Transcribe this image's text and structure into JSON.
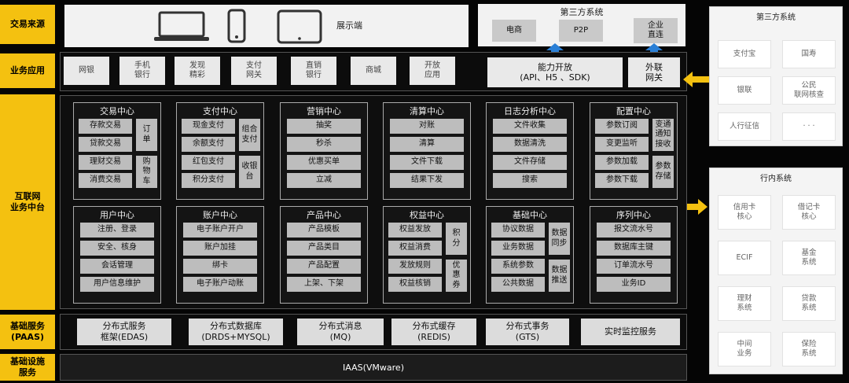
{
  "rows": {
    "source": "交易来源",
    "app": "业务应用",
    "platform": "互联网\n业务中台",
    "paas": "基础服务\n(PAAS)",
    "iaas": "基础设施\n服务"
  },
  "source_bar": {
    "label": "展示端"
  },
  "third_party_top": {
    "title": "第三方系统",
    "items": [
      "电商",
      "P2P",
      "企业\n直连"
    ]
  },
  "apps": [
    "网银",
    "手机\n银行",
    "发现\n精彩",
    "支付\n网关",
    "直销\n银行",
    "商城",
    "开放\n应用"
  ],
  "open_capability": "能力开放\n(API、H5 、SDK)",
  "external_gateway": "外联\n网关",
  "centers_top": [
    {
      "title": "交易中心",
      "left": [
        "存款交易",
        "贷款交易",
        "理财交易",
        "消费交易"
      ],
      "right": [
        "订\n单",
        "购\n物\n车"
      ]
    },
    {
      "title": "支付中心",
      "left": [
        "现金支付",
        "余额支付",
        "红包支付",
        "积分支付"
      ],
      "right": [
        "组合\n支付",
        "收银\n台"
      ]
    },
    {
      "title": "营销中心",
      "items": [
        "抽奖",
        "秒杀",
        "优惠买单",
        "立减"
      ]
    },
    {
      "title": "清算中心",
      "items": [
        "对账",
        "清算",
        "文件下载",
        "结果下发"
      ]
    },
    {
      "title": "日志分析中心",
      "items": [
        "文件收集",
        "数据清洗",
        "文件存储",
        "搜索"
      ]
    },
    {
      "title": "配置中心",
      "left": [
        "参数订阅",
        "变更监听",
        "参数加载",
        "参数下载"
      ],
      "right": [
        "变通\n通知\n接收",
        "参数\n存储"
      ]
    }
  ],
  "centers_bottom": [
    {
      "title": "用户中心",
      "items": [
        "注册、登录",
        "安全、核身",
        "会话管理",
        "用户信息维护"
      ]
    },
    {
      "title": "账户中心",
      "items": [
        "电子账户开户",
        "账户加挂",
        "绑卡",
        "电子账户动账"
      ]
    },
    {
      "title": "产品中心",
      "items": [
        "产品模板",
        "产品类目",
        "产品配置",
        "上架、下架"
      ]
    },
    {
      "title": "权益中心",
      "left": [
        "权益发放",
        "权益消费",
        "发放规则",
        "权益核销"
      ],
      "right": [
        "积\n分",
        "优\n惠\n券"
      ]
    },
    {
      "title": "基础中心",
      "left": [
        "协议数据",
        "业务数据",
        "系统参数",
        "公共数据"
      ],
      "right": [
        "数据\n同步",
        "数据\n推送"
      ]
    },
    {
      "title": "序列中心",
      "items": [
        "报文流水号",
        "数据库主键",
        "订单流水号",
        "业务ID"
      ]
    }
  ],
  "paas_items": [
    "分布式服务\n框架(EDAS)",
    "分布式数据库\n(DRDS+MYSQL)",
    "分布式消息\n(MQ)",
    "分布式缓存\n(REDIS)",
    "分布式事务\n(GTS)",
    "实时监控服务"
  ],
  "iaas": "IAAS(VMware)",
  "third_party_right": {
    "title": "第三方系统",
    "items": [
      "支付宝",
      "国寿",
      "银联",
      "公民\n联网核查",
      "人行征信",
      "· · ·"
    ]
  },
  "internal": {
    "title": "行内系统",
    "items": [
      "信用卡\n核心",
      "借记卡\n核心",
      "ECIF",
      "基金\n系统",
      "理财\n系统",
      "贷款\n系统",
      "中间\n业务",
      "保险\n系统"
    ]
  },
  "colors": {
    "accent": "#f4c110",
    "arrow_blue": "#2a7fd6"
  }
}
